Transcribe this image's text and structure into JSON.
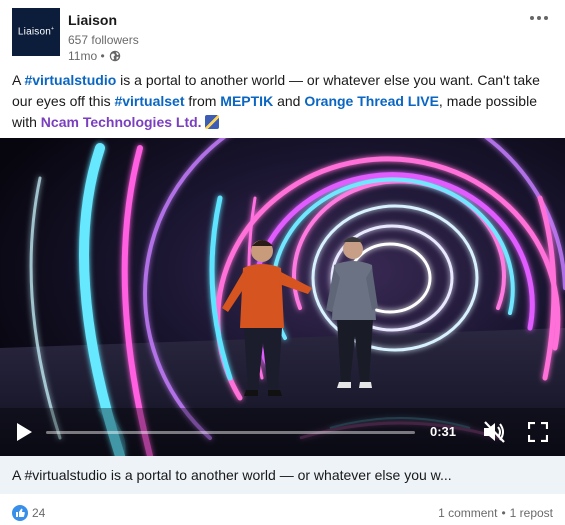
{
  "actor": {
    "logo_text": "Liaison",
    "logo_mark": "+",
    "name": "Liaison",
    "followers": "657 followers",
    "time": "11mo •"
  },
  "commentary": {
    "p1": "A ",
    "tag1": "#virtualstudio",
    "p2": " is a portal to another world — or whatever else you want. Can't take our eyes off this ",
    "tag2": "#virtualset",
    "p3": " from ",
    "org1": "MEPTIK",
    "p4": " and ",
    "org2": "Orange Thread LIVE",
    "p5": ", made possible with ",
    "org3": "Ncam Technologies Ltd.",
    "emoji": "pencil-emoji"
  },
  "video": {
    "time_remaining": "0:31",
    "progress": 0.0
  },
  "caption": "A #virtualstudio is a portal to another world — or whatever else you w...",
  "social": {
    "reaction_count": "24",
    "comments": "1 comment",
    "separator": "•",
    "reposts": "1 repost"
  },
  "colors": {
    "link": "#0a66c2",
    "org_purple": "#7a3fbf",
    "caption_bg": "#eef3f8",
    "logo_bg": "#0c1d3b"
  }
}
